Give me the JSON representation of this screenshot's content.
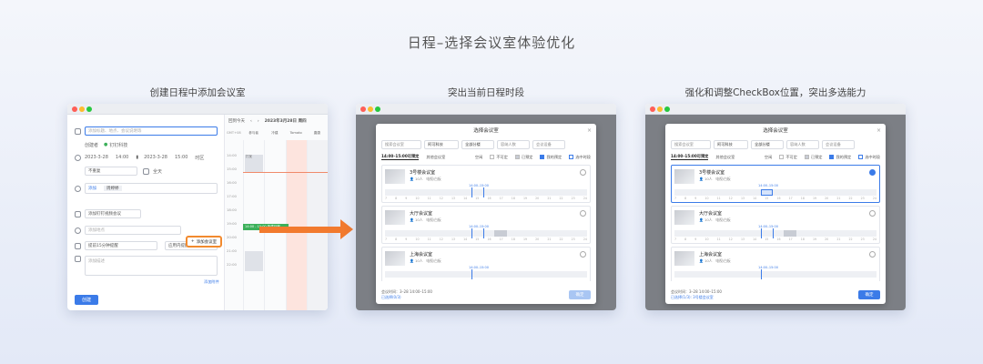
{
  "main_title": "日程–选择会议室体验优化",
  "sections": [
    {
      "title": "创建日程中添加会议室"
    },
    {
      "title": "突出当前日程时段"
    },
    {
      "title": "强化和调整CheckBox位置，突出多选能力"
    }
  ],
  "create_event": {
    "title_placeholder": "添加标题、地点、会议说明等",
    "creator_label": "创建者",
    "creator_name": "钉钉科技",
    "start_date": "2023-3-28",
    "start_time": "14:00",
    "end_date": "2023-3-28",
    "end_time": "15:00",
    "timezone": "时区",
    "repeat": "不重复",
    "all_day": "全天",
    "add_participant": "添加",
    "participant_name": "周婷婷",
    "video_meeting": "添加钉钉视频会议",
    "location_placeholder": "添加地点",
    "add_room_button": "添加会议室",
    "reminder": "提前15分钟提醒",
    "reminder_type": "应用内提醒",
    "desc_placeholder": "添加描述",
    "add_attachment": "添加附件",
    "create_button": "创建"
  },
  "calendar": {
    "today_btn": "回到今天",
    "date_header": "2023年3月28日 周四",
    "tz": "GMT+08",
    "columns": [
      "参与者",
      "冷建",
      "Tomato",
      "唐唐"
    ],
    "times": [
      "14:00",
      "15:00",
      "16:00",
      "17:00",
      "18:00",
      "19:00",
      "20:00",
      "21:00",
      "22:00"
    ],
    "event_label": "打扰",
    "green_event": "14:00 - 15:00 新建日程"
  },
  "dialog": {
    "title": "选择会议室",
    "close": "×",
    "search_placeholder": "搜索会议室",
    "org": "阿可科技",
    "building": "全部分楼",
    "capacity_placeholder": "容纳人数",
    "device_placeholder": "会议设备",
    "tab_time": "14:00–15:00可预定",
    "tab_all": "其他会议室",
    "legend_free": "空闲",
    "legend_unavailable": "不可定",
    "legend_booked": "已预定",
    "legend_mine": "我的预定",
    "legend_selected": "选中时段",
    "rooms": [
      {
        "name": "3号楼会议室",
        "capacity": "10人",
        "device": "电视/白板",
        "range": "14:00–15:00"
      },
      {
        "name": "大厅会议室",
        "capacity": "10人",
        "device": "电视/白板",
        "range": "14:00–15:00"
      },
      {
        "name": "上海会议室",
        "capacity": "10人",
        "device": "电视/白板",
        "range": "14:00–15:00"
      }
    ],
    "ticks": [
      "7",
      "8",
      "9",
      "10",
      "11",
      "12",
      "13",
      "14",
      "15",
      "16",
      "17",
      "18",
      "19",
      "20",
      "21",
      "22",
      "23",
      "24"
    ],
    "foot_time": "会议时间：3–28 14:00–15:00",
    "foot_selected_1": "已选择(0/3)",
    "foot_selected_2": "已选择(1/3): 3号楼会议室",
    "confirm": "确定"
  },
  "colors": {
    "accent": "#3b7be8",
    "highlight_orange": "#f27a2e",
    "event_green": "#3cb05a"
  }
}
